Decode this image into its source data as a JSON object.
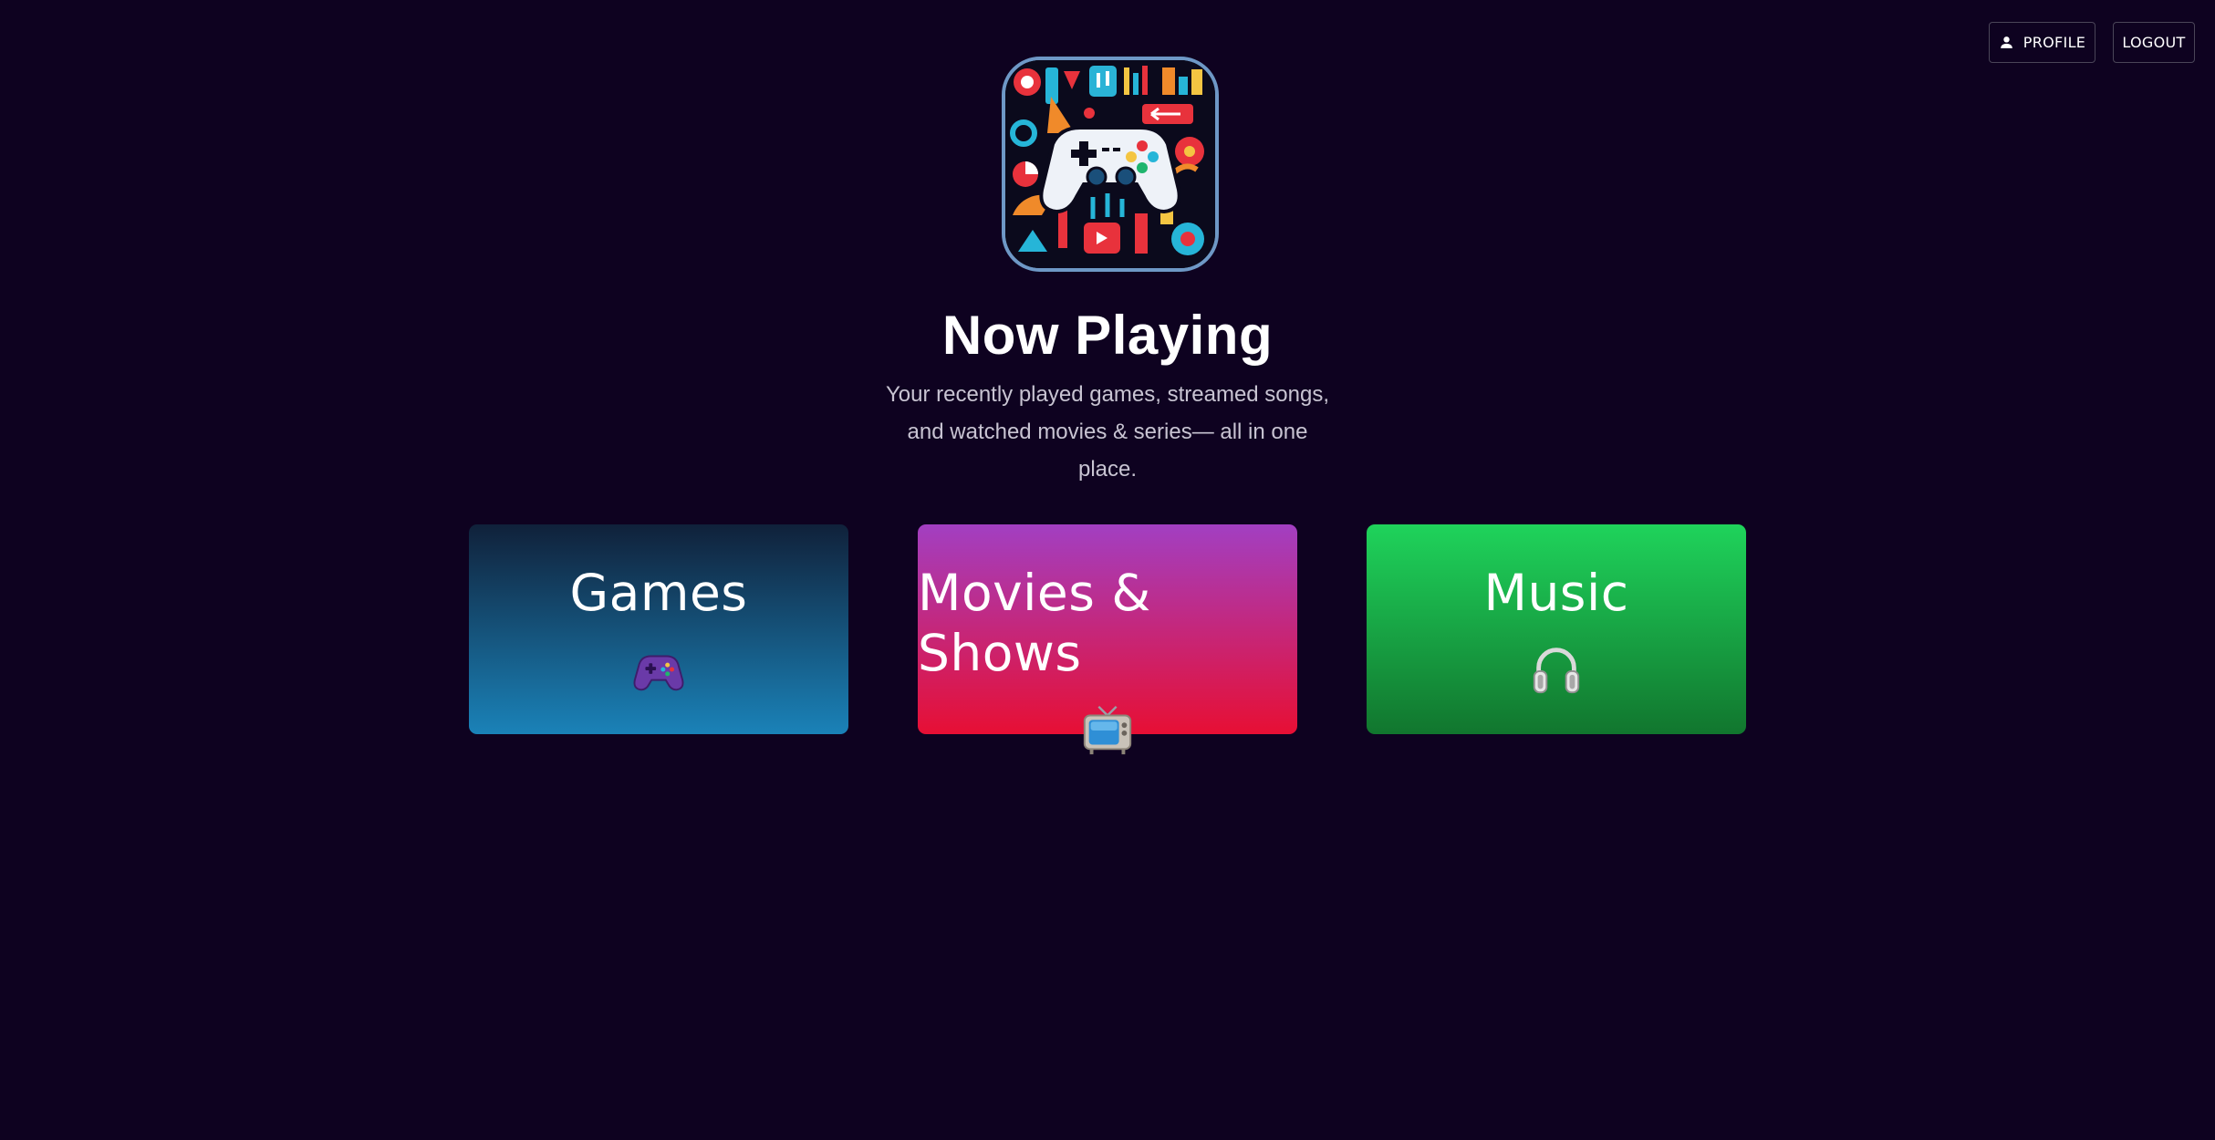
{
  "header": {
    "profile_label": "PROFILE",
    "logout_label": "LOGOUT"
  },
  "hero": {
    "logo_icon": "gamepad-collage-logo",
    "title": "Now Playing",
    "subtitle": "Your recently played games, streamed songs, and watched movies & series— all in one place."
  },
  "cards": [
    {
      "label": "Games",
      "icon": "gamepad-icon",
      "gradient": [
        "#10213a",
        "#1a82b8"
      ]
    },
    {
      "label": "Movies & Shows",
      "icon": "television-icon",
      "gradient": [
        "#a23fc2",
        "#e70f34"
      ]
    },
    {
      "label": "Music",
      "icon": "headphones-icon",
      "gradient": [
        "#1fd35b",
        "#11762e"
      ]
    }
  ],
  "colors": {
    "background": "#0e0220",
    "text": "#ffffff",
    "subtitle": "#c8c4d2"
  }
}
